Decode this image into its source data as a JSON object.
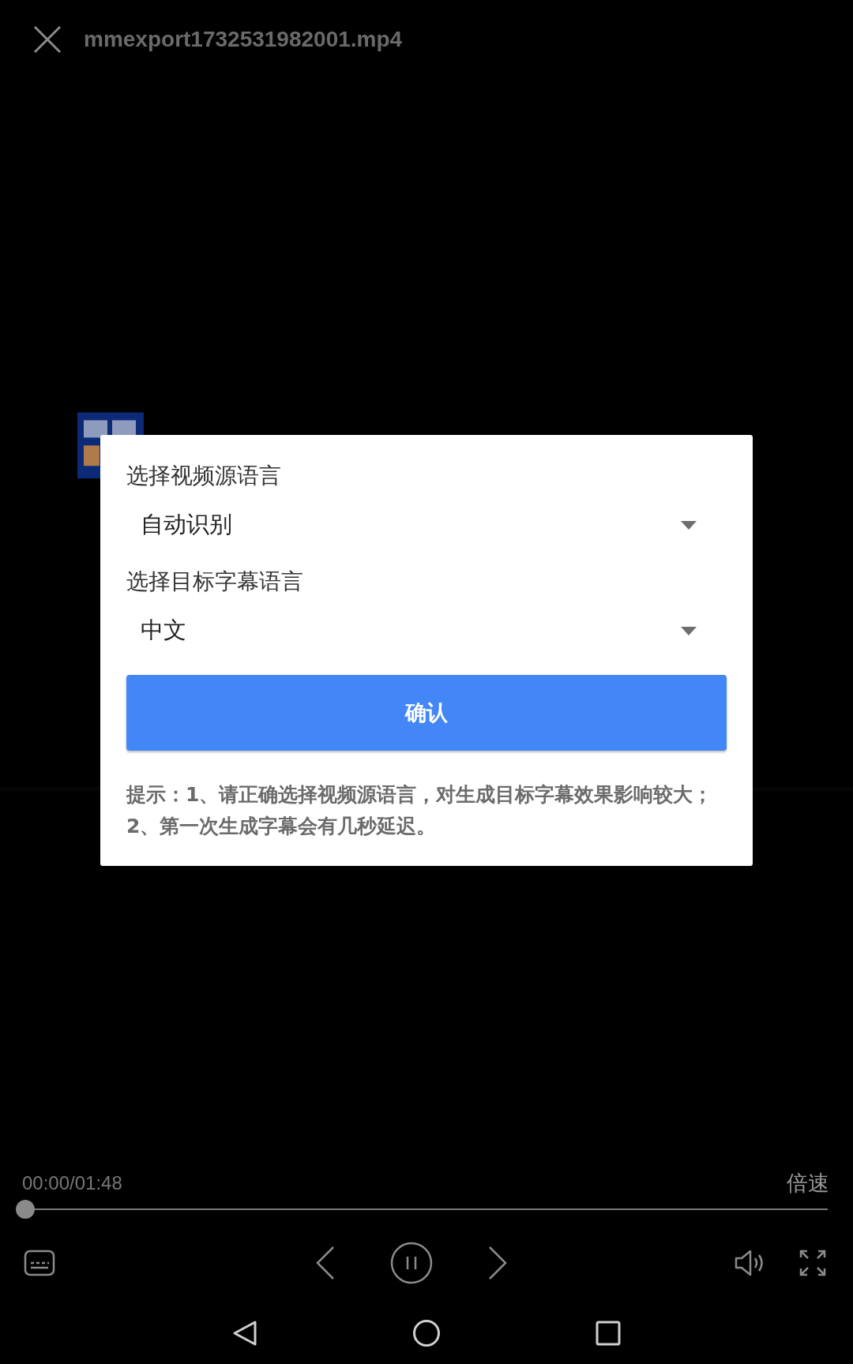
{
  "title": "mmexport1732531982001.mp4",
  "dialog": {
    "fields": [
      {
        "label": "选择视频源语言",
        "value": "自动识别"
      },
      {
        "label": "选择目标字幕语言",
        "value": "中文"
      }
    ],
    "confirm": "确认",
    "hint": "提示：1、请正确选择视频源语言，对生成目标字幕效果影响较大；2、第一次生成字幕会有几秒延迟。"
  },
  "player": {
    "time": "00:00/01:48",
    "speed": "倍速",
    "progress": {
      "level": 0
    }
  }
}
